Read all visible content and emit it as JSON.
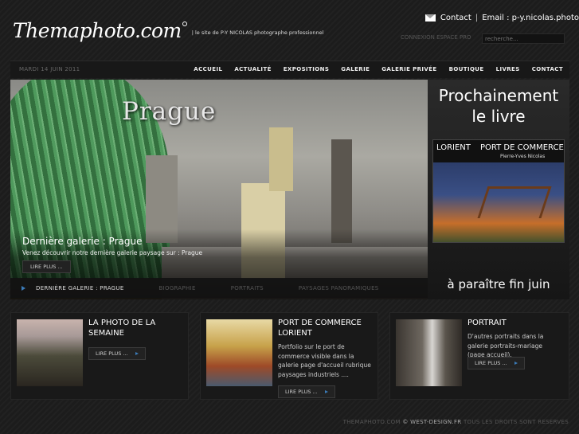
{
  "header": {
    "logo_text": "Themaphoto.com",
    "logo_tagline": "| le site de P-Y NICOLAS photographe professionnel",
    "contact_label": "Contact",
    "separator": "|",
    "email_label": "Email : p-y.nicolas.photo",
    "login_link": "CONNEXION ESPACE PRO",
    "search_placeholder": "recherche..."
  },
  "navbar": {
    "date": "MARDI 14 JUIN 2011",
    "items": [
      "ACCUEIL",
      "ACTUALITÉ",
      "EXPOSITIONS",
      "GALERIE",
      "GALERIE PRIVÉE",
      "BOUTIQUE",
      "LIVRES",
      "CONTACT"
    ]
  },
  "hero": {
    "city_title": "Prague",
    "caption_title": "Dernière galerie : Prague",
    "caption_desc": "Venez découvrir notre dernière galerie paysage sur : Prague",
    "read_more": "LIRE PLUS ...",
    "tabs": [
      "DERNIÈRE GALERIE : PRAGUE",
      "BIOGRAPHIE",
      "PORTRAITS",
      "PAYSAGES PANORAMIQUES"
    ]
  },
  "book": {
    "headline_1": "Prochainement",
    "headline_2": "le livre",
    "cover_title_1": "LORIENT",
    "cover_title_2": "PORT DE COMMERCE",
    "cover_author": "Pierre-Yves Nicolas",
    "footer": "à paraître fin juin"
  },
  "cards": [
    {
      "title_1": "LA PHOTO DE LA",
      "title_2": "SEMAINE",
      "desc": "",
      "button": "LIRE PLUS ..."
    },
    {
      "title_1": "PORT DE COMMERCE",
      "title_2": "LORIENT",
      "desc": "Portfolio sur le port de commerce visible dans la galerie page d'accueil rubrique paysages industriels ....",
      "button": "LIRE PLUS ..."
    },
    {
      "title_1": "PORTRAIT",
      "title_2": "",
      "desc": "D'autres portraits dans la galerie portraits-mariage (page accueil).",
      "button": "LIRE PLUS ..."
    }
  ],
  "footer": {
    "text_1": "THEMAPHOTO.COM",
    "text_2": "© WEST-DESIGN.FR",
    "text_3": "TOUS LES DROITS SONT RESERVES"
  },
  "colors": {
    "background": "#1c1c1c",
    "accent_arrow": "#3b7bb8",
    "dome_green": "#4b9a5a"
  }
}
